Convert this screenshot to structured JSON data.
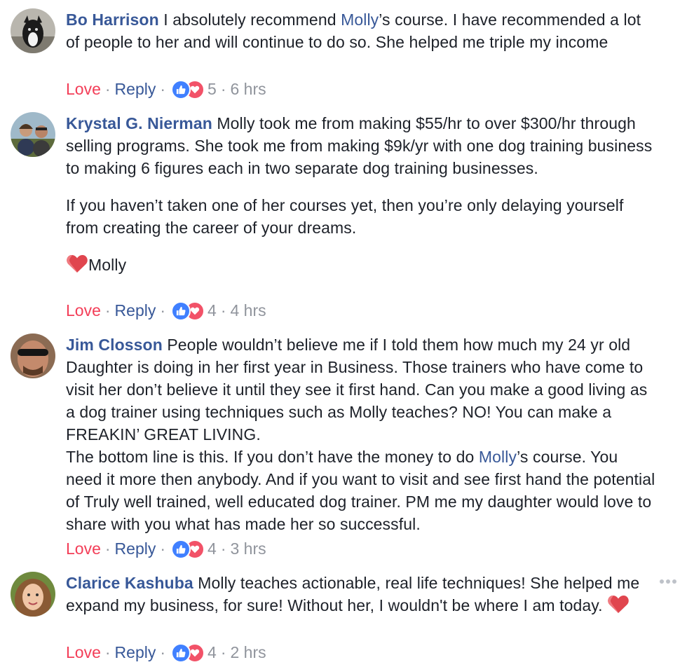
{
  "comments": [
    {
      "name": "Bo Harrison",
      "text_before": " I absolutely recommend ",
      "mention": "Molly",
      "text_after": "’s course. I have recommended a lot of people to her and will continue to do so. She helped me triple my income",
      "actions": {
        "love": "Love",
        "reply": "Reply",
        "count": "5",
        "time": "6 hrs"
      }
    },
    {
      "name": "Krystal G. Nierman",
      "text": " Molly took me from making $55/hr to over $300/hr through selling programs. She took me from making $9k/yr with one dog training business to making 6 figures each in two separate dog training businesses.",
      "text2": "If you haven’t taken one of her courses yet, then you’re only delaying yourself from creating the career of your dreams.",
      "signoff": "Molly",
      "actions": {
        "love": "Love",
        "reply": "Reply",
        "count": "4",
        "time": "4 hrs"
      }
    },
    {
      "name": "Jim Closson",
      "text": " People wouldn’t believe me if I told them how much my 24 yr old Daughter is doing in her first year in Business. Those trainers who have come to visit her don’t believe it until they see it first hand. Can you make a good living as a dog trainer using techniques such as Molly teaches? NO! You can make a FREAKIN’ GREAT LIVING.",
      "text2_before": "The bottom line is this. If you don’t have the money to do ",
      "mention": "Molly",
      "text2_after": "’s course. You need it more then anybody. And if you want to visit and see first hand the potential of Truly well trained, well educated dog trainer. PM me my daughter would love to share with you what has made her so successful.",
      "actions": {
        "love": "Love",
        "reply": "Reply",
        "count": "4",
        "time": "3 hrs"
      }
    },
    {
      "name": "Clarice Kashuba",
      "text": " Molly teaches actionable, real life techniques! She helped me expand my business, for sure! Without her, I wouldn't be where I am today. ",
      "actions": {
        "love": "Love",
        "reply": "Reply",
        "count": "4",
        "time": "2 hrs"
      }
    }
  ],
  "colors": {
    "link": "#385898",
    "love": "#f33e58",
    "meta": "#90949c",
    "like_blue": "#4080ff",
    "heart_red": "#f25268"
  },
  "icons": [
    "avatar",
    "like-icon",
    "love-reaction-icon",
    "heart-emoji-icon",
    "more-options-icon"
  ]
}
